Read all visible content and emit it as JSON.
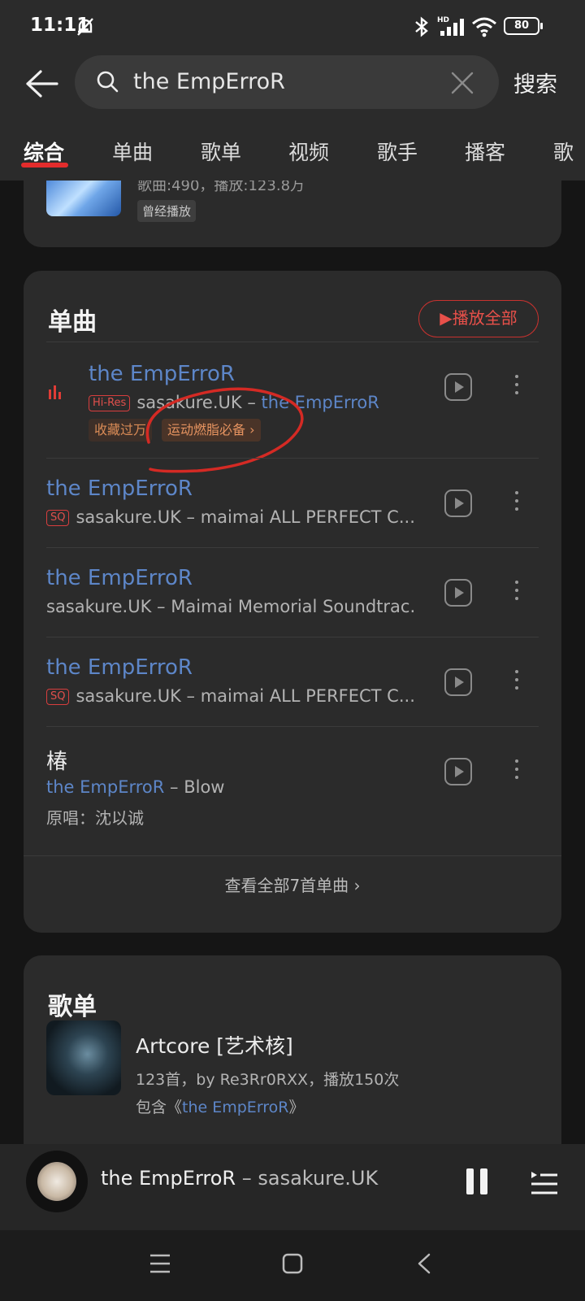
{
  "status_bar": {
    "time": "11:11",
    "battery": "80",
    "icons": [
      "dnd-off-icon",
      "bluetooth-icon",
      "hd-signal-icon",
      "wifi-icon",
      "battery-icon"
    ]
  },
  "search": {
    "query": "the EmpErroR",
    "submit_label": "搜索"
  },
  "tabs": [
    {
      "label": "综合",
      "active": true
    },
    {
      "label": "单曲"
    },
    {
      "label": "歌单"
    },
    {
      "label": "视频"
    },
    {
      "label": "歌手"
    },
    {
      "label": "播客"
    },
    {
      "label": "歌"
    }
  ],
  "top_playlist": {
    "meta": "歌曲:490，播放:123.8万",
    "badge": "曾经播放"
  },
  "songs_section": {
    "title": "单曲",
    "play_all_label": "播放全部",
    "view_all_label": "查看全部7首单曲",
    "songs": [
      {
        "title": "the EmpErroR",
        "quality": "Hi-Res",
        "artist": "sasakure.UK",
        "sep": " – ",
        "album": "the EmpErroR",
        "tags": [
          "收藏过万",
          "运动燃脂必备"
        ],
        "playing": true
      },
      {
        "title": "the EmpErroR",
        "quality": "SQ",
        "artist": "sasakure.UK",
        "sep": " – ",
        "album": "maimai ALL PERFECT C..."
      },
      {
        "title": "the EmpErroR",
        "quality": "",
        "artist": "sasakure.UK",
        "sep": " – ",
        "album": "Maimai Memorial Soundtrac..."
      },
      {
        "title": "the EmpErroR",
        "quality": "SQ",
        "artist": "sasakure.UK",
        "sep": " – ",
        "album": "maimai ALL PERFECT C..."
      },
      {
        "title": "椿",
        "quality": "",
        "artist": "the EmpErroR",
        "sep": " – ",
        "album": "Blow",
        "original": "原唱：沈以诚"
      }
    ]
  },
  "playlists_section": {
    "title": "歌单",
    "items": [
      {
        "title": "Artcore [艺术核]",
        "meta": "123首，by Re3Rr0RXX，播放150次",
        "include_prefix": "包含《",
        "include_song": "the EmpErroR",
        "include_suffix": "》"
      }
    ]
  },
  "now_playing": {
    "title": "the EmpErroR",
    "sep": " – ",
    "artist": "sasakure.UK"
  },
  "colors": {
    "accent": "#e32c2c",
    "link": "#5d86c8",
    "background": "#151515",
    "card": "#2b2b2b"
  }
}
